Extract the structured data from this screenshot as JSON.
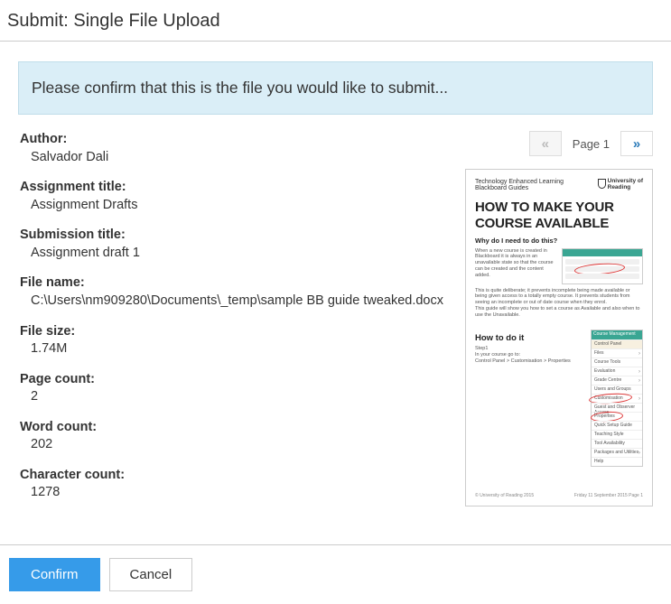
{
  "header": {
    "title": "Submit: Single File Upload"
  },
  "alert": {
    "message": "Please confirm that this is the file you would like to submit..."
  },
  "fields": {
    "author": {
      "label": "Author:",
      "value": "Salvador Dali"
    },
    "assignmentTitle": {
      "label": "Assignment title:",
      "value": "Assignment Drafts"
    },
    "submissionTitle": {
      "label": "Submission title:",
      "value": "Assignment draft 1"
    },
    "fileName": {
      "label": "File name:",
      "value": "C:\\Users\\nm909280\\Documents\\_temp\\sample BB guide tweaked.docx"
    },
    "fileSize": {
      "label": "File size:",
      "value": "1.74M"
    },
    "pageCount": {
      "label": "Page count:",
      "value": "2"
    },
    "wordCount": {
      "label": "Word count:",
      "value": "202"
    },
    "charCount": {
      "label": "Character count:",
      "value": "1278"
    }
  },
  "pager": {
    "prev": "«",
    "label": "Page 1",
    "next": "»"
  },
  "preview": {
    "brandLine1": "Technology Enhanced Learning",
    "brandLine2": "Blackboard Guides",
    "uniLine1": "University of",
    "uniLine2": "Reading",
    "titleLine1": "HOW TO MAKE YOUR",
    "titleLine2": "COURSE AVAILABLE",
    "q1": "Why do I need to do this?",
    "q2": "How to do it",
    "step1": "Step1",
    "step2": "In your course go to:",
    "step3": "Control Panel > Customisation > Properties",
    "footerLeft": "© University of Reading 2015",
    "footerRight": "Friday 11 September 2015    Page 1"
  },
  "footer": {
    "confirm": "Confirm",
    "cancel": "Cancel"
  }
}
